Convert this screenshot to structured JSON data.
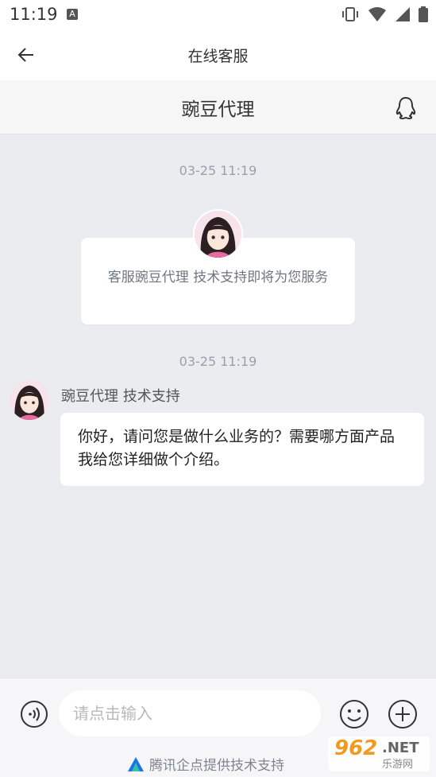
{
  "status_bar": {
    "time": "11:19",
    "notification_icon": "A"
  },
  "nav": {
    "title": "在线客服",
    "back_icon": "arrow-left-icon"
  },
  "header": {
    "title": "豌豆代理",
    "qq_icon": "qq-penguin-icon"
  },
  "chat": {
    "timestamp_1": "03-25 11:19",
    "service_notice": "客服豌豆代理 技术支持即将为您服务",
    "timestamp_2": "03-25 11:19",
    "agent_name": "豌豆代理 技术支持",
    "agent_message": "你好，请问您是做什么业务的？需要哪方面产品我给您详细做个介绍。"
  },
  "input_bar": {
    "placeholder": "请点击输入",
    "voice_icon": "voice-icon",
    "emoji_icon": "emoji-icon",
    "plus_icon": "plus-icon"
  },
  "footer": {
    "powered_by": "腾讯企点提供技术支持"
  },
  "watermark": {
    "number": "962",
    "domain": ".NET",
    "subtitle": "乐游网"
  },
  "colors": {
    "background": "#ebecf0",
    "accent": "#1a73e8"
  }
}
